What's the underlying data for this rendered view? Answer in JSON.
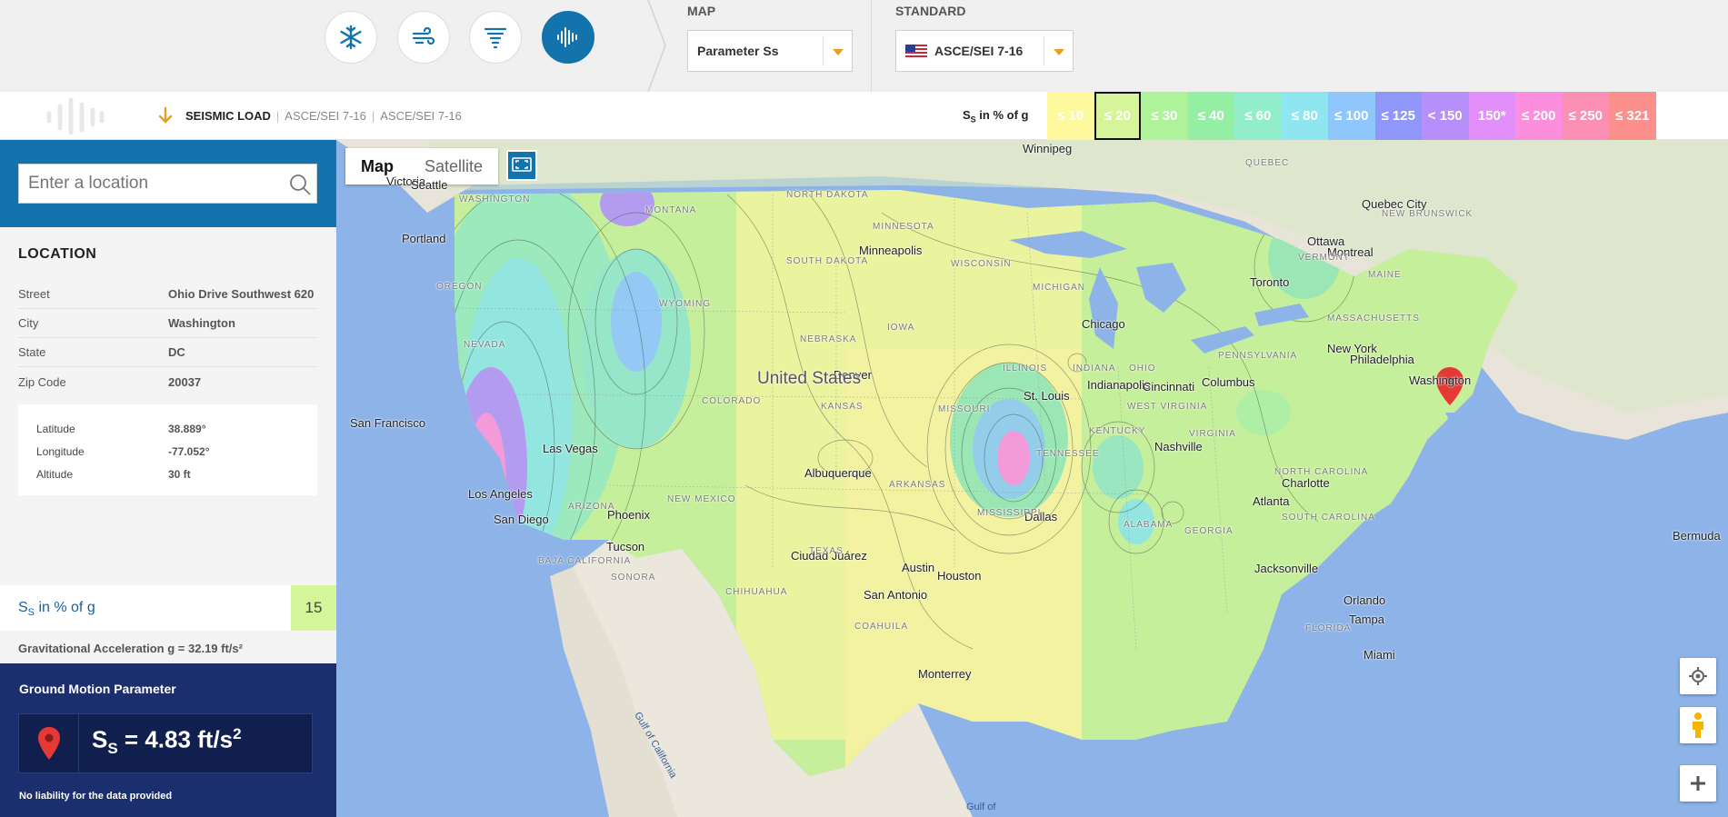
{
  "toolbar": {
    "load_types": [
      {
        "name": "snow",
        "icon": "snowflake-icon",
        "active": false
      },
      {
        "name": "wind",
        "icon": "wind-icon",
        "active": false
      },
      {
        "name": "tornado",
        "icon": "tornado-icon",
        "active": false
      },
      {
        "name": "seismic",
        "icon": "seismic-wave-icon",
        "active": true
      }
    ],
    "map_label": "MAP",
    "map_value": "Parameter Ss",
    "standard_label": "STANDARD",
    "standard_value": "ASCE/SEI 7-16"
  },
  "breadcrumb": {
    "load": "SEISMIC LOAD",
    "standard_1": "ASCE/SEI 7-16",
    "standard_2": "ASCE/SEI 7-16"
  },
  "legend": {
    "title_main": "S",
    "title_sub": "S",
    "title_rest": " in % of g",
    "selected_index": 1,
    "bins": [
      {
        "label": "≤ 10",
        "color": "#fdf99c"
      },
      {
        "label": "≤ 20",
        "color": "#d6f59a"
      },
      {
        "label": "≤ 30",
        "color": "#aef39a"
      },
      {
        "label": "≤ 40",
        "color": "#94eea3"
      },
      {
        "label": "≤ 60",
        "color": "#91edcb"
      },
      {
        "label": "≤ 80",
        "color": "#8fe6f1"
      },
      {
        "label": "≤ 100",
        "color": "#8fc6fb"
      },
      {
        "label": "≤ 125",
        "color": "#8f97fb"
      },
      {
        "label": "< 150",
        "color": "#b78ffb"
      },
      {
        "label": "150*",
        "color": "#e28ffa"
      },
      {
        "label": "≤ 200",
        "color": "#fb8fde"
      },
      {
        "label": "≤ 250",
        "color": "#fb8fb4"
      },
      {
        "label": "≤ 321",
        "color": "#fb8f8c"
      }
    ]
  },
  "search": {
    "placeholder": "Enter a location"
  },
  "location": {
    "title": "LOCATION",
    "fields": [
      {
        "key": "Street",
        "value": "Ohio Drive Southwest 620"
      },
      {
        "key": "City",
        "value": "Washington"
      },
      {
        "key": "State",
        "value": "DC"
      },
      {
        "key": "Zip Code",
        "value": "20037"
      }
    ],
    "coords": [
      {
        "key": "Latitude",
        "value": "38.889°"
      },
      {
        "key": "Longitude",
        "value": "-77.052°"
      },
      {
        "key": "Altitude",
        "value": "30 ft"
      }
    ]
  },
  "result": {
    "label_main": "S",
    "label_sub": "S",
    "label_rest": " in % of g",
    "value": "15",
    "gravity": "Gravitational Acceleration g = 32.19 ft/s²"
  },
  "ground_motion": {
    "title": "Ground Motion Parameter",
    "symbol": "S",
    "symbol_sub": "S",
    "equation": " = 4.83 ft/s",
    "exponent": "2",
    "note": "No liability for the data provided"
  },
  "map": {
    "type_map": "Map",
    "type_satellite": "Satellite",
    "country": "United States",
    "cities": [
      "Winnipeg",
      "Victoria",
      "Seattle",
      "Portland",
      "Minneapolis",
      "Quebec City",
      "Ottawa",
      "Montreal",
      "Toronto",
      "Chicago",
      "Denver",
      "San Francisco",
      "St. Louis",
      "Indianapolis",
      "Cincinnati",
      "Columbus",
      "Philadelphia",
      "New York",
      "Washington",
      "Las Vegas",
      "Nashville",
      "Charlotte",
      "Atlanta",
      "Albuquerque",
      "Los Angeles",
      "Phoenix",
      "San Diego",
      "Dallas",
      "Tucson",
      "Ciudad Juárez",
      "Austin",
      "Houston",
      "San Antonio",
      "Jacksonville",
      "Orlando",
      "Tampa",
      "Miami",
      "Monterrey",
      "Bermuda"
    ],
    "regions": [
      "WASHINGTON",
      "MONTANA",
      "NORTH DAKOTA",
      "MINNESOTA",
      "SOUTH DAKOTA",
      "WYOMING",
      "WISCONSIN",
      "MICHIGAN",
      "IOWA",
      "NEBRASKA",
      "ILLINOIS",
      "INDIANA",
      "OHIO",
      "PENNSYLVANIA",
      "KANSAS",
      "MISSOURI",
      "KENTUCKY",
      "WEST VIRGINIA",
      "VIRGINIA",
      "TENNESSEE",
      "NORTH CAROLINA",
      "SOUTH CAROLINA",
      "ARKANSAS",
      "MISSISSIPPI",
      "ALABAMA",
      "GEORGIA",
      "TEXAS",
      "NEW MEXICO",
      "COLORADO",
      "OREGON",
      "NEVADA",
      "ARIZONA",
      "BAJA CALIFORNIA",
      "SONORA",
      "CHIHUAHUA",
      "COAHUILA",
      "FLORIDA",
      "VERMONT",
      "MAINE",
      "MASSACHUSETTS",
      "NEW BRUNSWICK",
      "QUEBEC"
    ],
    "water": [
      "Gulf of California",
      "Gulf of"
    ]
  }
}
